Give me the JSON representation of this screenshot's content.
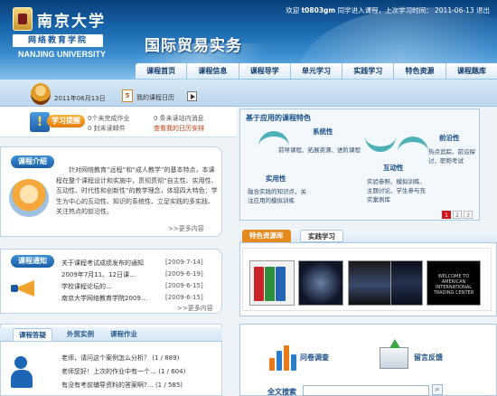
{
  "header": {
    "university_cn": "南京大学",
    "school": "网络教育学院",
    "university_en": "NANJING UNIVERSITY",
    "course_title": "国际贸易实务",
    "welcome_prefix": "欢迎",
    "username": "t0803gm",
    "welcome_suffix": "同学进入课程，上次学习时间：",
    "last_visit": "2011-06-13",
    "logout": "退出"
  },
  "nav": [
    "课程首页",
    "课程信息",
    "课程导学",
    "单元学习",
    "实践学习",
    "特色资源",
    "课程题库"
  ],
  "subbar": {
    "date": "2011年06月13日",
    "calendar_day": "5",
    "schedule_label": "我的课程日历"
  },
  "reminder": {
    "label": "学习提醒",
    "unfinished": "0个未完成作业",
    "unread_mail": "0 封未读邮件",
    "unread_msg": "0 条未读站内消息",
    "calendar_link": "查看我的日历安排"
  },
  "intro": {
    "tab": "课程介绍",
    "text": "针对网络教育“远程”和“成人教学”的基本特点，本课程在整个课程设计和实施中，贯彻贯彻“自主性、实用性、互动性、时代性和创新性”的教学理念，体现四大特色：学生为中心的互动性、知识的系统性、立足实践的多实践、关注热点的前沿性。",
    "more": ">>更多内容"
  },
  "notices": {
    "tab": "课程通知",
    "items": [
      {
        "title": "关于课程考试成绩发布的通知",
        "date": "[2009-7-14]"
      },
      {
        "title": "2009年7月11、12日课…",
        "date": "[2009-6-19]"
      },
      {
        "title": "学校课程论坛的…",
        "date": "[2009-6-15]"
      },
      {
        "title": "南京大学网络教育学院2009…",
        "date": "[2009-6-15]"
      }
    ],
    "more": ">>更多内容"
  },
  "qa": {
    "tabs": [
      "课程答疑",
      "外贸实例",
      "课程作业"
    ],
    "items": [
      {
        "q": "老师，请问这个案例怎么分析？",
        "n": "(1 / 889)"
      },
      {
        "q": "老师您好！上次的作业中有一个…",
        "n": "(1 / 604)"
      },
      {
        "q": "有没有考前辅导资料的答案啊?…",
        "n": "(1 / 585)"
      }
    ]
  },
  "banner": {
    "title": "基于应用的课程特色",
    "practical_label": "实用性",
    "practical_text": "融合实践的知识点，关注应用的模拟训练",
    "system_label": "系统性",
    "system_text": "前导课程、拓展资源、进阶课程",
    "interactive_label": "互动性",
    "interactive_text": "实验参照、模拟训练、主题讨论、学生参与充实案例库",
    "frontier_label": "前沿性",
    "frontier_text": "热点追踪、前沿探讨、职称考试",
    "pages": [
      "1",
      "2",
      "3"
    ]
  },
  "resources": {
    "tabs": [
      "特色资源库",
      "实践学习"
    ],
    "video_caption": "WELCOME TO AMERICAN INTERNATIONAL TRADING CENTER"
  },
  "bottom": {
    "survey": "问卷调查",
    "feedback": "留言反馈",
    "search_label": "全文搜索"
  },
  "colors": {
    "brand_blue": "#1766ab",
    "accent_orange": "#e58a1f",
    "teal": "#4fb1b8"
  }
}
